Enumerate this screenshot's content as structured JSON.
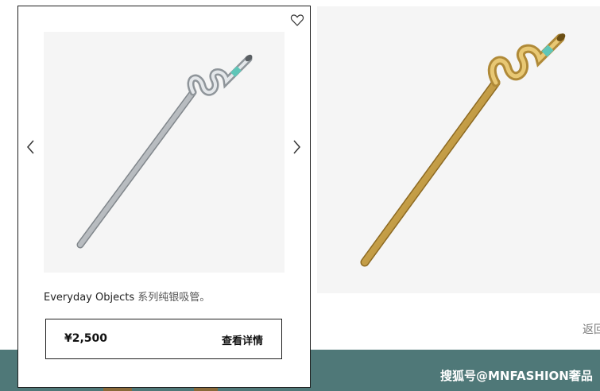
{
  "card": {
    "name_en": "Everyday Objects",
    "name_zh": "系列纯银吸管。",
    "price": "¥2,500",
    "detail_label": "查看详情"
  },
  "page": {
    "back_link": "返回",
    "watermark": "搜狐号@MNFASHION奢品"
  },
  "icons": {
    "wishlist": "heart-outline-icon",
    "prev": "chevron-left-icon",
    "next": "chevron-right-icon"
  },
  "colors": {
    "band": "#4f7878",
    "photo_bg": "#f5f5f5",
    "turquoise": "#5fc6b8",
    "gold": "#c9a24a",
    "silver": "#b8bcc0"
  }
}
